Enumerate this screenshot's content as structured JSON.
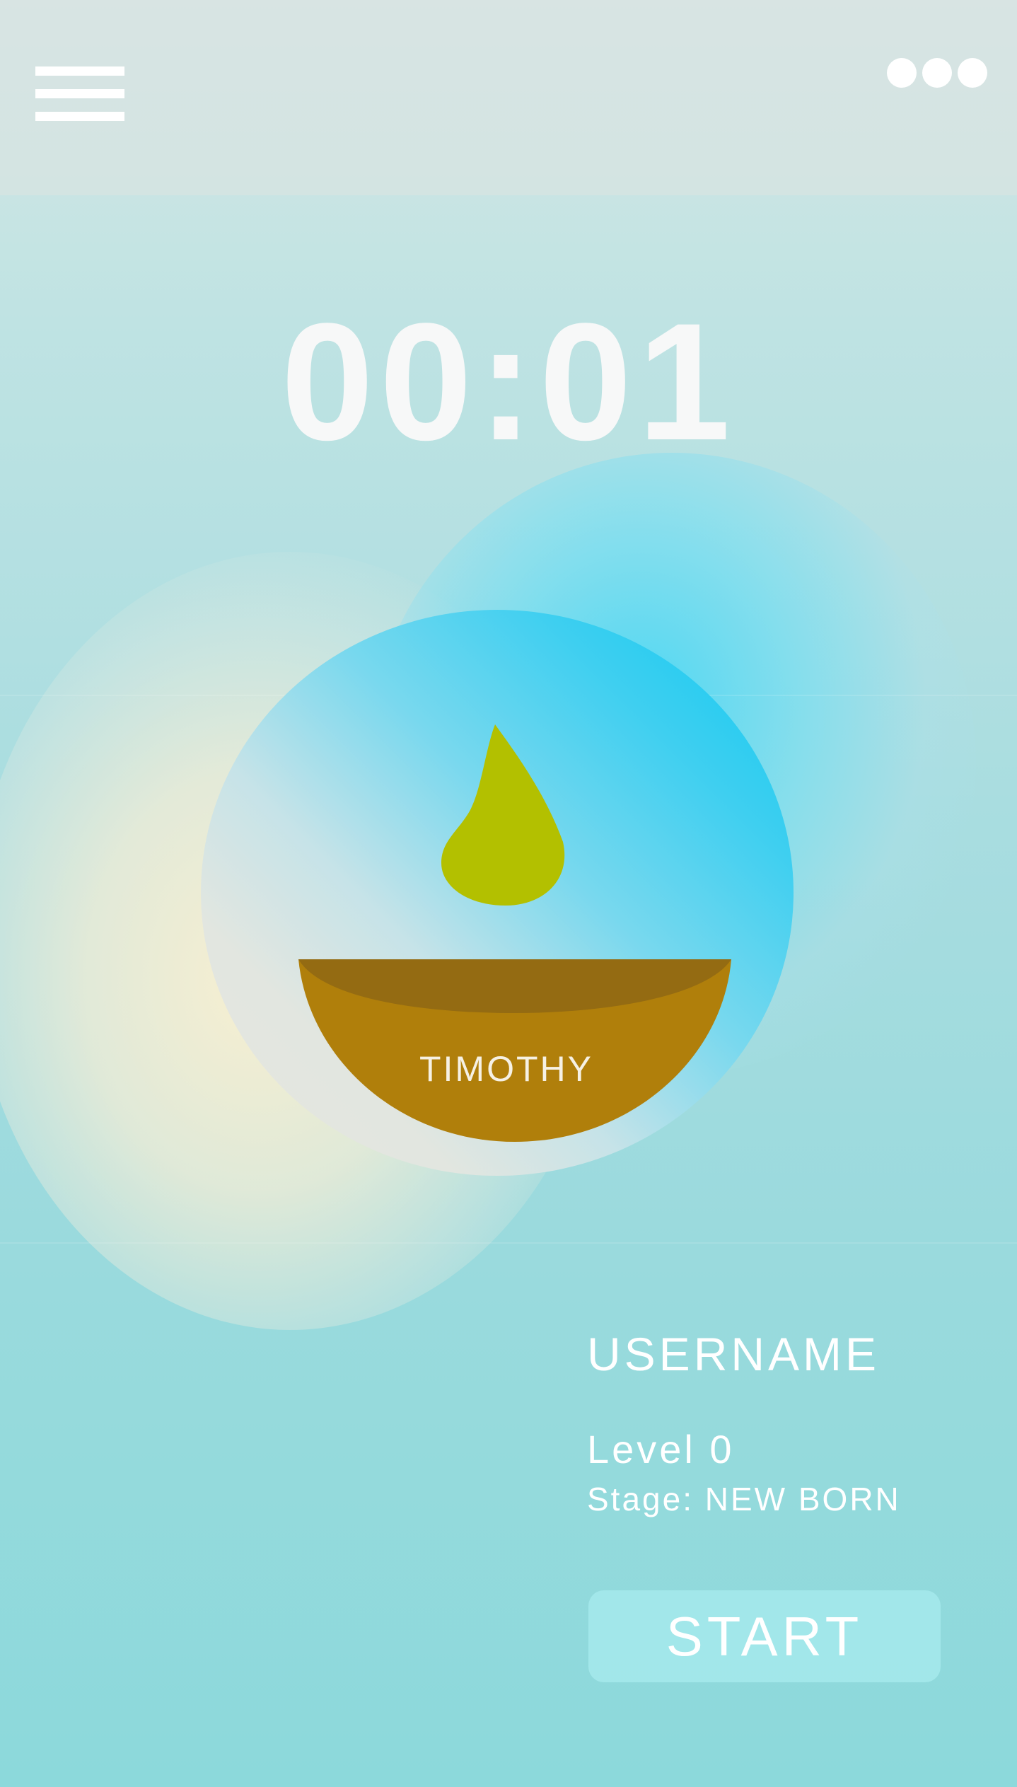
{
  "header": {
    "menu_icon": "hamburger-menu-icon",
    "more_icon": "more-options-icon"
  },
  "timer": {
    "value": "00:01"
  },
  "plant": {
    "seed_icon": "seed-drop-icon",
    "pot_icon": "pot-icon",
    "name": "TIMOTHY",
    "colors": {
      "seed": "#b3c000",
      "pot": "#b07f0b",
      "pot_rim": "#946b12",
      "orb_accent": "#0cc8f2"
    }
  },
  "profile": {
    "username": "USERNAME",
    "level": "Level 0",
    "stage": "Stage: NEW BORN"
  },
  "actions": {
    "start_label": "START"
  }
}
